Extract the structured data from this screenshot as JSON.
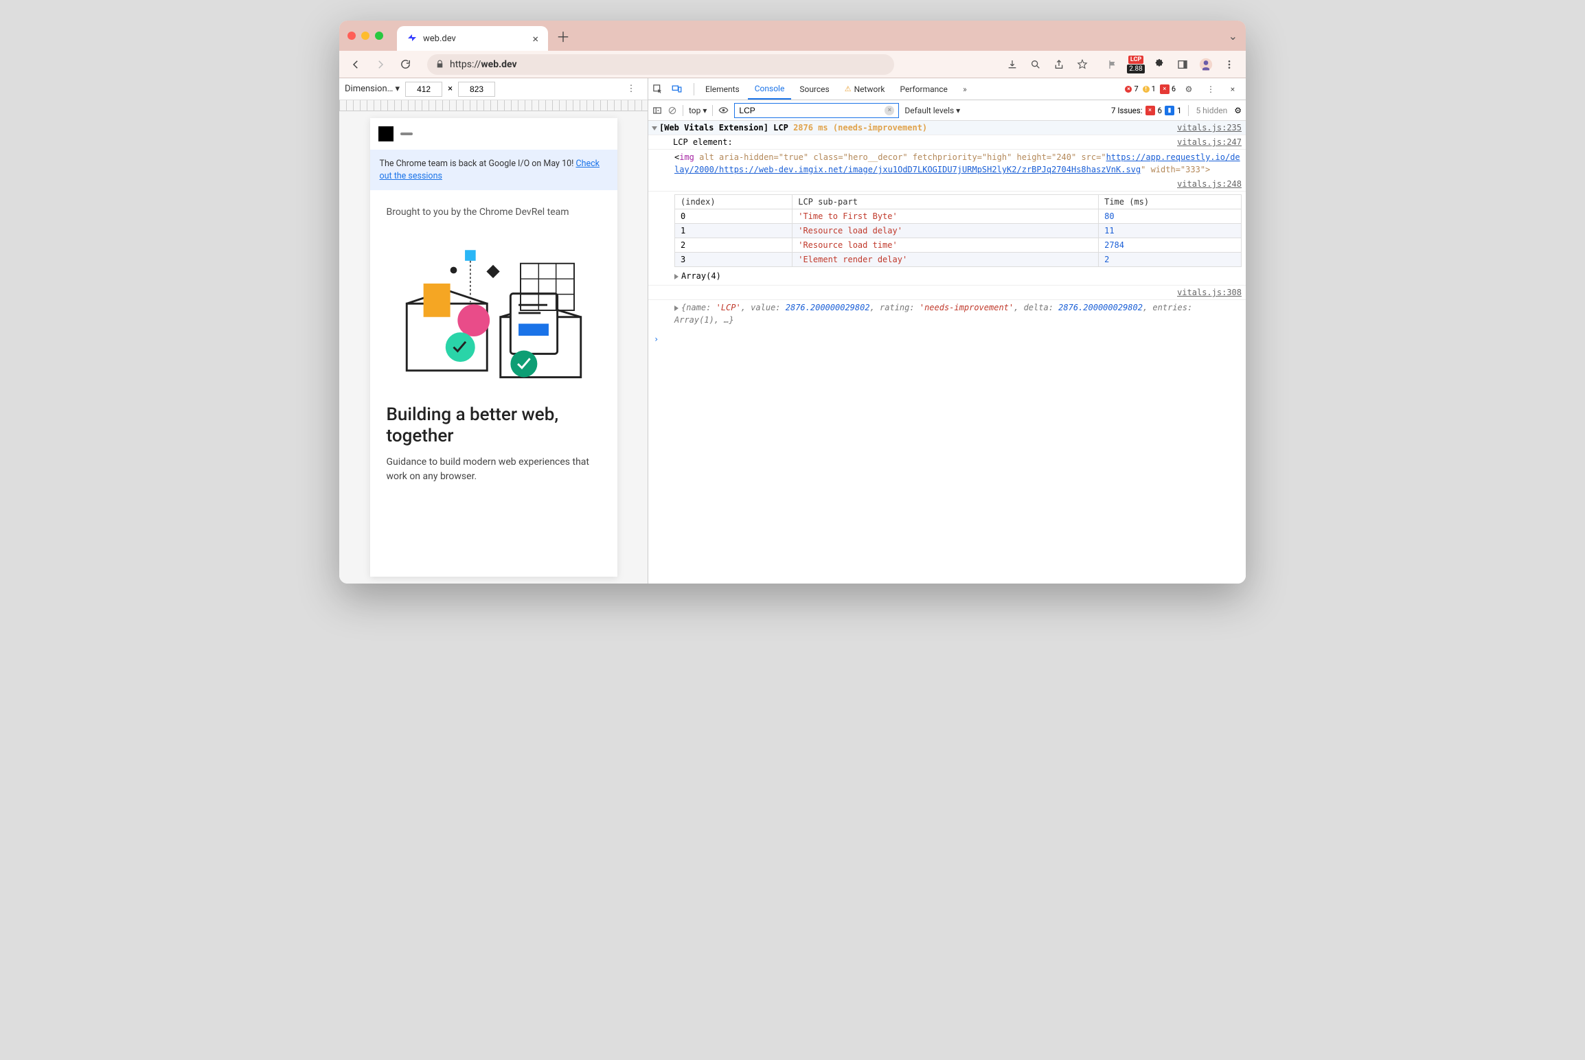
{
  "titlebar": {
    "tab_title": "web.dev"
  },
  "toolbar": {
    "url_scheme": "https://",
    "url_host": "web.dev",
    "lcp_label": "LCP",
    "lcp_value": "2.88"
  },
  "device_bar": {
    "label": "Dimension… ▾",
    "width": "412",
    "times": "×",
    "height": "823"
  },
  "preview": {
    "banner_pre": "The Chrome team is back at Google I/O on May 10! ",
    "banner_link": "Check out the sessions",
    "brought": "Brought to you by the Chrome DevRel team",
    "heading": "Building a better web, together",
    "sub": "Guidance to build modern web experiences that work on any browser."
  },
  "devtools": {
    "tabs": [
      "Elements",
      "Console",
      "Sources",
      "Network",
      "Performance"
    ],
    "active_tab": "Console",
    "err_count": "7",
    "warn_count": "1",
    "block_count": "6",
    "context": "top ▾",
    "filter_value": "LCP",
    "levels": "Default levels ▾",
    "issues_label": "7 Issues:",
    "issues_err": "6",
    "issues_info": "1",
    "hidden": "5 hidden"
  },
  "logs": {
    "head_prefix": "[Web Vitals Extension] LCP",
    "head_ms": "2876 ms",
    "head_rating": "(needs-improvement)",
    "head_src": "vitals.js:235",
    "elem_label": "LCP element:",
    "elem_src": "vitals.js:247",
    "elem_tag": "img",
    "elem_attrs_pre": " alt aria-hidden=\"true\" class=\"hero__decor\" fetchpriority=\"high\" height=\"240\" src=\"",
    "elem_url": "https://app.requestly.io/delay/2000/https://web-dev.imgix.net/image/jxu1OdD7LKOGIDU7jURMpSH2lyK2/zrBPJq2704Hs8haszVnK.svg",
    "elem_attrs_post": "\" width=\"333\">",
    "table_src": "vitals.js:248",
    "table_headers": [
      "(index)",
      "LCP sub-part",
      "Time (ms)"
    ],
    "table_rows": [
      {
        "index": "0",
        "part": "'Time to First Byte'",
        "time": "80"
      },
      {
        "index": "1",
        "part": "'Resource load delay'",
        "time": "11"
      },
      {
        "index": "2",
        "part": "'Resource load time'",
        "time": "2784"
      },
      {
        "index": "3",
        "part": "'Element render delay'",
        "time": "2"
      }
    ],
    "array_label": "Array(4)",
    "obj_src": "vitals.js:308",
    "obj_text_1": "{name:",
    "obj_name": "'LCP'",
    "obj_text_2": ", value:",
    "obj_value": "2876.200000029802",
    "obj_text_3": ", rating:",
    "obj_rating": "'needs-improvement'",
    "obj_text_4": ", delta:",
    "obj_delta": "2876.200000029802",
    "obj_text_5": ", entries:",
    "obj_entries": "Array(1)",
    "obj_text_6": ", …}"
  }
}
